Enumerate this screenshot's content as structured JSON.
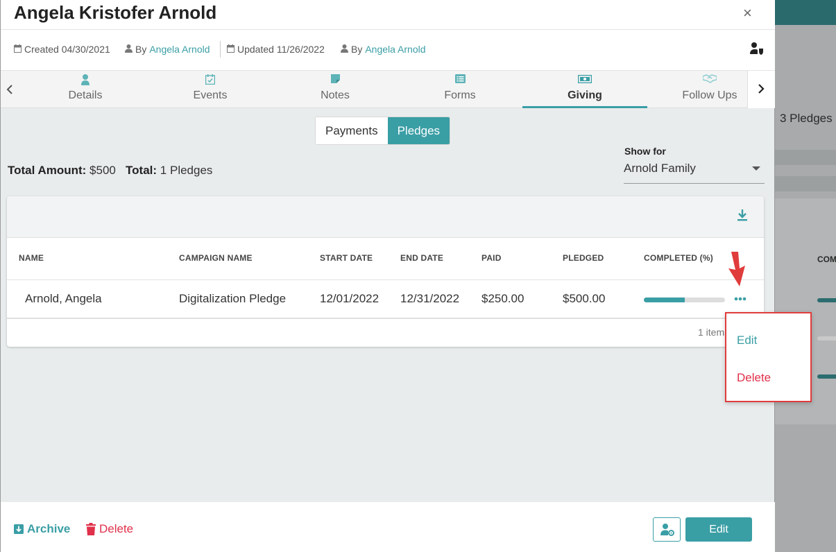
{
  "page": {
    "title": "Angela Kristofer Arnold",
    "close_glyph": "×"
  },
  "meta": {
    "created": "Created 04/30/2021",
    "created_by_prefix": "By",
    "created_by": "Angela Arnold",
    "updated": "Updated 11/26/2022",
    "updated_by_prefix": "By",
    "updated_by": "Angela Arnold"
  },
  "tabs": [
    {
      "label": "Details",
      "icon": "user-icon"
    },
    {
      "label": "Events",
      "icon": "calendar-check-icon"
    },
    {
      "label": "Notes",
      "icon": "sticky-note-icon"
    },
    {
      "label": "Forms",
      "icon": "list-icon"
    },
    {
      "label": "Giving",
      "icon": "money-icon",
      "active": true
    },
    {
      "label": "Follow Ups",
      "icon": "handshake-icon"
    }
  ],
  "segment": {
    "payments": "Payments",
    "pledges": "Pledges",
    "selected": "Pledges"
  },
  "totals": {
    "amount_label": "Total Amount:",
    "amount_value": "$500",
    "total_label": "Total:",
    "total_value": "1 Pledges"
  },
  "show_for": {
    "label": "Show for",
    "value": "Arnold Family"
  },
  "table": {
    "columns": [
      "NAME",
      "CAMPAIGN NAME",
      "START DATE",
      "END DATE",
      "PAID",
      "PLEDGED",
      "COMPLETED (%)"
    ],
    "rows": [
      {
        "name": "Arnold, Angela",
        "campaign": "Digitalization Pledge",
        "start": "12/01/2022",
        "end": "12/31/2022",
        "paid": "$250.00",
        "pledged": "$500.00",
        "completed_pct": 50
      }
    ],
    "item_count": "1 item"
  },
  "row_menu": {
    "edit": "Edit",
    "delete": "Delete"
  },
  "footer": {
    "archive": "Archive",
    "delete": "Delete",
    "edit": "Edit"
  },
  "background": {
    "pledges_text": "3 Pledges",
    "column_fragment": "COM"
  },
  "colors": {
    "accent": "#3a9ea5",
    "danger": "#e0304a",
    "annotation": "#e03c3c"
  }
}
